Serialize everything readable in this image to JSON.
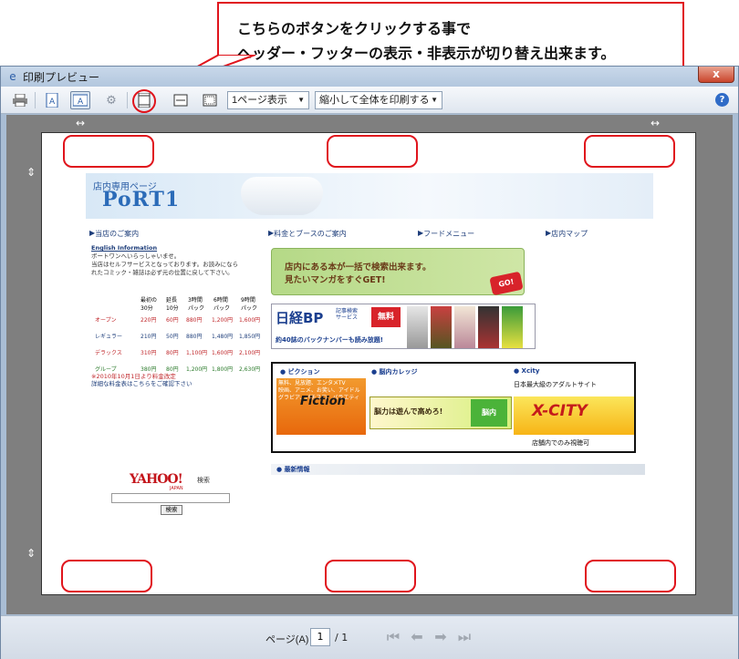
{
  "callout": {
    "line1": "こちらのボタンをクリックする事で",
    "line2": "ヘッダー・フッターの表示・非表示が切り替え出来ます。"
  },
  "window": {
    "title": "印刷プレビュー",
    "close_label": "x",
    "app_icon": "ie-icon"
  },
  "toolbar": {
    "page_view_select": "1ページ表示",
    "scale_select": "縮小して全体を印刷する",
    "help_label": "?",
    "icons": [
      "printer-icon",
      "portrait-icon",
      "landscape-icon",
      "gear-icon",
      "header-footer-toggle-icon",
      "full-width-icon",
      "page-setup-icon"
    ]
  },
  "pager": {
    "label": "ページ(A)",
    "current": "1",
    "total": "/ 1"
  },
  "webpage": {
    "store_label": "店内専用ページ",
    "logo": "PoRT1",
    "nav": [
      "当店のご案内",
      "料金とブースのご案内",
      "フードメニュー",
      "店内マップ"
    ],
    "english_link": "English Information",
    "intro": [
      "ポートワンへいらっしゃいませ。",
      "当店はセルフサービスとなっております。お読みになら",
      "れたコミック・雑誌は必ず元の位置に戻して下さい。"
    ],
    "price_headers": [
      "最初の\n30分",
      "延長\n10分",
      "3時間\nパック",
      "6時間\nパック",
      "9時間\nパック"
    ],
    "price_rows": [
      {
        "name": "オープン",
        "v": [
          "220円",
          "60円",
          "880円",
          "1,200円",
          "1,600円"
        ]
      },
      {
        "name": "レギュラー",
        "v": [
          "210円",
          "50円",
          "880円",
          "1,480円",
          "1,850円"
        ]
      },
      {
        "name": "デラックス",
        "v": [
          "310円",
          "80円",
          "1,100円",
          "1,600円",
          "2,100円"
        ]
      },
      {
        "name": "グループ",
        "v": [
          "380円",
          "80円",
          "1,200円",
          "1,800円",
          "2,630円"
        ]
      }
    ],
    "notice_red": "※2010年10月1日より料金改定",
    "notice": "詳細な料金表はこちらをご確認下さい",
    "banner_search_l1": "店内にある本が一括で検索出来ます。",
    "banner_search_l2": "見たいマンガをすぐGET!",
    "banner_go": "GO!",
    "nikkei_logo": "日経BP",
    "nikkei_service": "記事検索\nサービス",
    "nikkei_free": "無料",
    "nikkei_tagline": "約40誌のバックナンバーも読み放題!",
    "ad_heads": [
      "ピクション",
      "脳内カレッジ",
      "Xcity"
    ],
    "fiction_text": "無料、見放題、エンタメTV\n映画、アニメ、お笑い、アイドル\nグラビア、パチスロ、バラエティ",
    "fiction_logo": "Fiction",
    "noukatsu_text": "脳力は遊んで高めろ!",
    "noukatsu_badge": "脳内",
    "adult_label": "日本最大級のアダルトサイト",
    "xcity_logo": "X-CITY",
    "store_only": "店舗内でのみ視聴可",
    "latest_news": "最新情報",
    "yahoo_logo": "YAHOO!",
    "yahoo_sub": "JAPAN",
    "yahoo_search_label": "検索",
    "yahoo_button": "検索"
  },
  "colors": {
    "marker": "#e0141c",
    "preview_bg": "#7f7f7f",
    "window_frame": "#a9bdd4"
  }
}
